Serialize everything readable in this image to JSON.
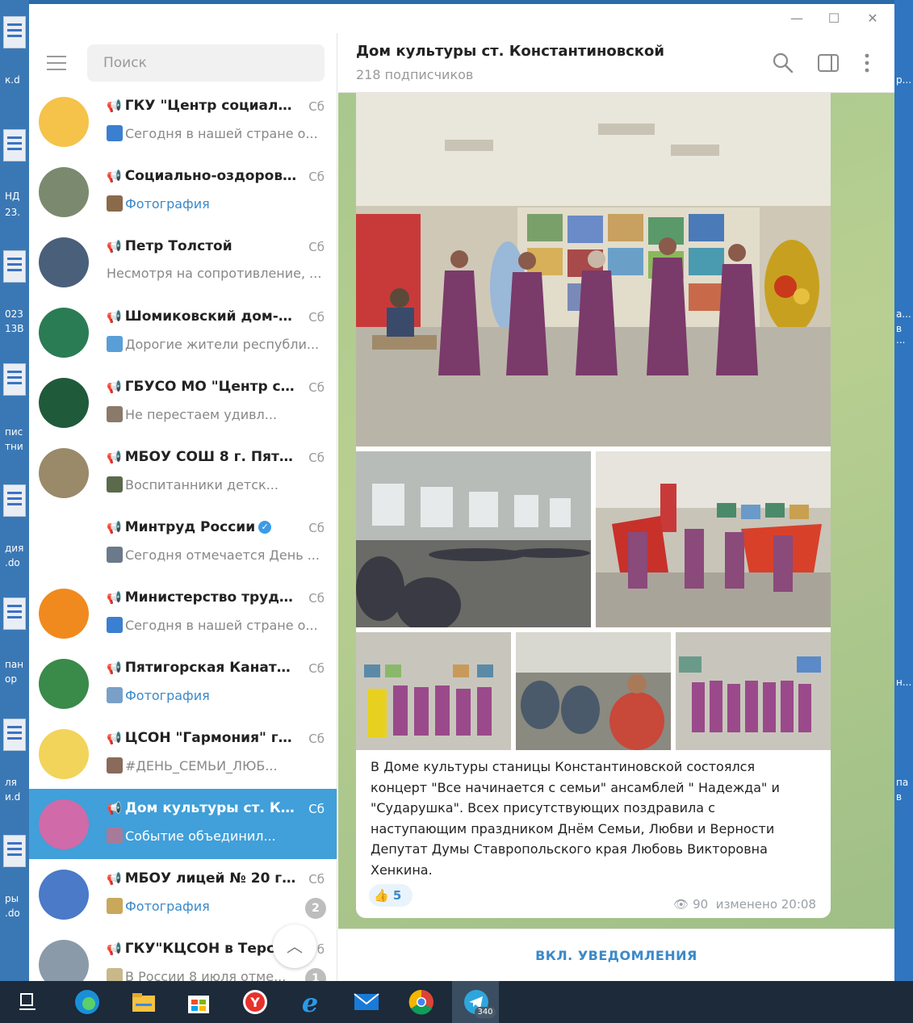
{
  "window": {
    "minimize_icon": "—",
    "maximize_icon": "☐",
    "close_icon": "✕"
  },
  "search": {
    "placeholder": "Поиск"
  },
  "chats": [
    {
      "name": "ГКУ \"Центр социальн...",
      "date": "Сб",
      "preview": "Сегодня в нашей стране о...",
      "preview_blue": false,
      "thumb_color": "#3b7fd0",
      "avatar_color": "#f5c24a"
    },
    {
      "name": "Социально-оздорови...",
      "date": "Сб",
      "preview": "Фотография",
      "preview_blue": true,
      "thumb_color": "#8a6a4a",
      "avatar_color": "#7b8a6e"
    },
    {
      "name": "Петр Толстой",
      "date": "Сб",
      "preview": "Несмотря на сопротивление, ...",
      "preview_blue": false,
      "thumb_color": "",
      "avatar_color": "#4a5f7a"
    },
    {
      "name": "Шомиковский дом-ин...",
      "date": "Сб",
      "preview": "Дорогие жители республи...",
      "preview_blue": false,
      "thumb_color": "#5a9ed8",
      "avatar_color": "#2a7c54"
    },
    {
      "name": "ГБУСО МО \"Центр соц...",
      "date": "Сб",
      "preview": "Не перестаем удивл...",
      "preview_blue": false,
      "thumb_color": "#8a7a6a",
      "avatar_color": "#1f5a3a"
    },
    {
      "name": "МБОУ СОШ 8 г. Пятиг...",
      "date": "Сб",
      "preview": "Воспитанники детск...",
      "preview_blue": false,
      "thumb_color": "#5a6a4a",
      "avatar_color": "#9a8a6a"
    },
    {
      "name": "Минтруд России",
      "date": "Сб",
      "preview": "Сегодня отмечается День ...",
      "preview_blue": false,
      "thumb_color": "#6a7a8a",
      "avatar_color": "#ffffff",
      "verified": true
    },
    {
      "name": "Министерство труда ...",
      "date": "Сб",
      "preview": "Сегодня в нашей стране о...",
      "preview_blue": false,
      "thumb_color": "#3b7fd0",
      "avatar_color": "#f08a1e"
    },
    {
      "name": "Пятигорская Канатна...",
      "date": "Сб",
      "preview": "Фотография",
      "preview_blue": true,
      "thumb_color": "#7aa0c8",
      "avatar_color": "#3a8a4a"
    },
    {
      "name": "ЦСОН \"Гармония\" г. Н...",
      "date": "Сб",
      "preview": "#ДЕНЬ_СЕМЬИ_ЛЮБ...",
      "preview_blue": false,
      "thumb_color": "#8a6a5a",
      "avatar_color": "#f2d45a"
    },
    {
      "name": "Дом культуры ст. Кон...",
      "date": "Сб",
      "preview": "Событие объединил...",
      "preview_blue": false,
      "thumb_color": "#a87a9a",
      "avatar_color": "#d06aa8",
      "active": true
    },
    {
      "name": "МБОУ лицей № 20 г. П...",
      "date": "Сб",
      "preview": "Фотография",
      "preview_blue": true,
      "thumb_color": "#c8a85a",
      "avatar_color": "#4a7ac8",
      "badge": "2"
    },
    {
      "name": "ГКУ\"КЦСОН в Терскс",
      "date": "б",
      "preview": "В России 8 июля отме...",
      "preview_blue": false,
      "thumb_color": "#c8b88a",
      "avatar_color": "#8a9aa8",
      "badge": "1"
    }
  ],
  "channel": {
    "title": "Дом культуры ст. Константиновской",
    "subscribers": "218 подписчиков",
    "message_text": "В Доме культуры станицы Константиновской состоялся концерт \"Все начинается с семьи\" ансамблей \" Надежда\" и \"Сударушка\". Всех присутствующих поздравила с наступающим праздником Днём Семьи, Любви и Верности Депутат Думы Ставропольского края Любовь Викторовна Хенкина.",
    "reaction_emoji": "👍",
    "reaction_count": "5",
    "views": "90",
    "edited": "изменено 20:08",
    "notify_button": "ВКЛ. УВЕДОМЛЕНИЯ"
  },
  "taskbar": {
    "telegram_badge": "340"
  },
  "desktop_labels": {
    "left": [
      "к.d",
      "НД",
      "23.",
      "023",
      "13В",
      "пис",
      "тни",
      "дия",
      ".do",
      "пан",
      "ор",
      "ля",
      "и.d",
      "ры",
      ".do"
    ],
    "right": [
      "р...",
      "а...",
      "в ...",
      "н...",
      "па",
      "в"
    ]
  }
}
